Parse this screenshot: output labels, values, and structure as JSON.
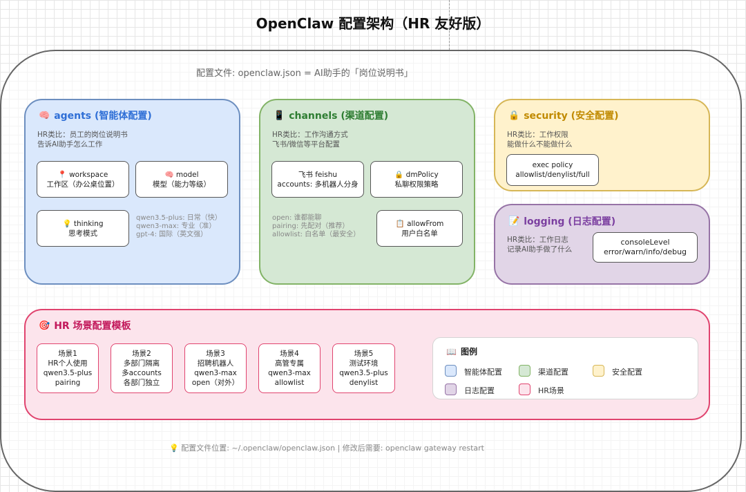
{
  "title": "OpenClaw 配置架构（HR 友好版）",
  "subtitle": "配置文件: openclaw.json = AI助手的「岗位说明书」",
  "agents": {
    "icon": "🧠",
    "title": "agents (智能体配置)",
    "desc": [
      "HR类比：员工的岗位说明书",
      "告诉AI助手怎么工作"
    ],
    "items": [
      {
        "icon": "📍",
        "name": "workspace",
        "desc": "工作区（办公桌位置）"
      },
      {
        "icon": "🧠",
        "name": "model",
        "desc": "模型（能力等级）"
      },
      {
        "icon": "💡",
        "name": "thinking",
        "desc": "思考模式"
      }
    ],
    "model_notes": [
      "qwen3.5-plus: 日常（快）",
      "qwen3-max: 专业（准）",
      "gpt-4: 国际（英文强）"
    ]
  },
  "channels": {
    "icon": "📱",
    "title": "channels (渠道配置)",
    "desc": [
      "HR类比：工作沟通方式",
      "飞书/微信等平台配置"
    ],
    "items": [
      {
        "icon": "",
        "name": "飞书 feishu",
        "desc": "accounts: 多机器人分身"
      },
      {
        "icon": "🔒",
        "name": "dmPolicy",
        "desc": "私聊权限策略"
      },
      {
        "icon": "📋",
        "name": "allowFrom",
        "desc": "用户白名单"
      }
    ],
    "policy_notes": [
      "open: 谁都能聊",
      "pairing: 先配对（推荐）",
      "allowlist: 白名单（最安全）"
    ]
  },
  "security": {
    "icon": "🔒",
    "title": "security (安全配置)",
    "desc": [
      "HR类比：工作权限",
      "能做什么不能做什么"
    ],
    "item": {
      "name": "exec policy",
      "desc": "allowlist/denylist/full"
    }
  },
  "logging": {
    "icon": "📝",
    "title": "logging (日志配置)",
    "desc": [
      "HR类比：工作日志",
      "记录AI助手做了什么"
    ],
    "item": {
      "name": "consoleLevel",
      "desc": "error/warn/info/debug"
    }
  },
  "hr": {
    "icon": "🎯",
    "title": "HR 场景配置模板",
    "scenes": [
      {
        "name": "场景1",
        "lines": [
          "HR个人使用",
          "qwen3.5-plus",
          "pairing"
        ]
      },
      {
        "name": "场景2",
        "lines": [
          "多部门隔离",
          "多accounts",
          "各部门独立"
        ]
      },
      {
        "name": "场景3",
        "lines": [
          "招聘机器人",
          "qwen3-max",
          "open（对外）"
        ]
      },
      {
        "name": "场景4",
        "lines": [
          "高管专属",
          "qwen3-max",
          "allowlist"
        ]
      },
      {
        "name": "场景5",
        "lines": [
          "测试环境",
          "qwen3.5-plus",
          "denylist"
        ]
      }
    ]
  },
  "legend": {
    "icon": "📖",
    "title": "图例",
    "items": [
      {
        "label": "智能体配置",
        "fill": "#dae8fc",
        "stroke": "#6c8ebf"
      },
      {
        "label": "渠道配置",
        "fill": "#d5e8d4",
        "stroke": "#82b366"
      },
      {
        "label": "安全配置",
        "fill": "#fff2cc",
        "stroke": "#d6b656"
      },
      {
        "label": "日志配置",
        "fill": "#e1d5e7",
        "stroke": "#9673a6"
      },
      {
        "label": "HR场景",
        "fill": "#fce4ec",
        "stroke": "#e0436e"
      }
    ]
  },
  "footer": "💡 配置文件位置: ~/.openclaw/openclaw.json | 修改后需要: openclaw gateway restart"
}
